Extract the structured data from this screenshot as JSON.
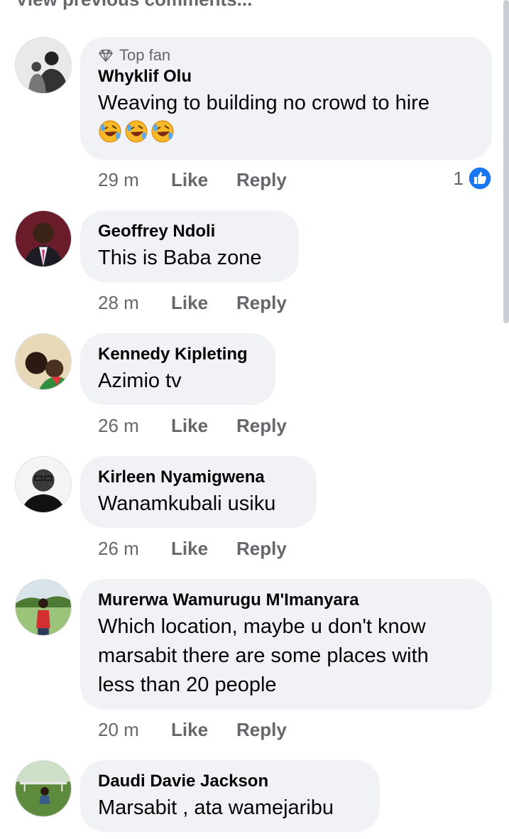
{
  "header": {
    "view_previous": "View previous comments..."
  },
  "comments": [
    {
      "badge": "Top fan",
      "author": "Whyklif Olu",
      "text": "Weaving to building no crowd to hire",
      "emoji": "🤣🤣🤣",
      "time": "29 m",
      "like": "Like",
      "reply": "Reply",
      "reaction_count": "1"
    },
    {
      "author": "Geoffrey Ndoli",
      "text": "This is Baba zone",
      "time": "28 m",
      "like": "Like",
      "reply": "Reply"
    },
    {
      "author": "Kennedy Kipleting",
      "text": "Azimio tv",
      "time": "26 m",
      "like": "Like",
      "reply": "Reply"
    },
    {
      "author": "Kirleen Nyamigwena",
      "text": "Wanamkubali usiku",
      "time": "26 m",
      "like": "Like",
      "reply": "Reply"
    },
    {
      "author": "Murerwa Wamurugu M'Imanyara",
      "text_lines": [
        "Which location, maybe u don't know",
        "marsabit there are some places with",
        "less than 20 people"
      ],
      "time": "20 m",
      "like": "Like",
      "reply": "Reply"
    },
    {
      "author": "Daudi Davie Jackson",
      "text": "Marsabit , ata wamejaribu"
    }
  ],
  "colors": {
    "bubble": "#f0f2f5",
    "secondary_text": "#65676b",
    "like_blue": "#1877f2"
  }
}
